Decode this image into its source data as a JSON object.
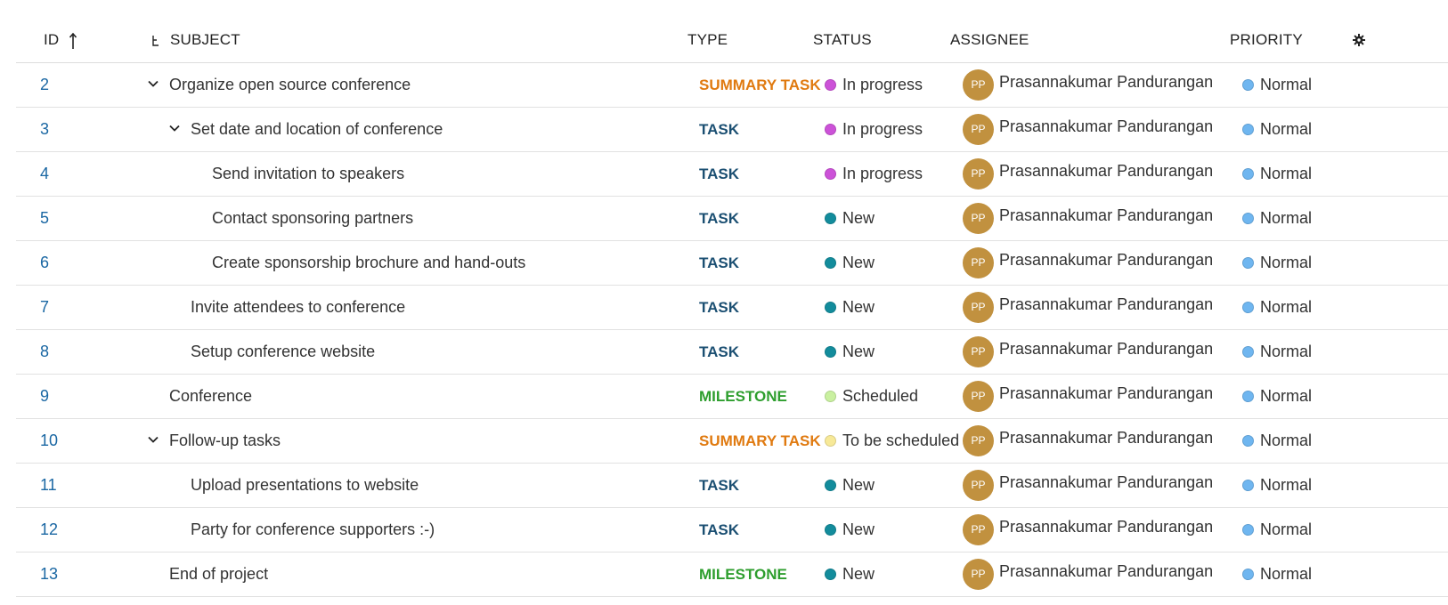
{
  "columns": {
    "id": "ID",
    "subject": "SUBJECT",
    "type": "TYPE",
    "status": "STATUS",
    "assignee": "ASSIGNEE",
    "priority": "PRIORITY"
  },
  "colors": {
    "link": "#1a67a3",
    "summary_task": "#e07a10",
    "task": "#1b4f72",
    "milestone": "#2e9e2e",
    "status_in_progress": "#cc52d8",
    "status_new": "#138c9c",
    "status_scheduled": "#c9f0a0",
    "status_to_be_scheduled": "#f7e998",
    "priority_normal": "#6fb6f0",
    "avatar": "#c1913f"
  },
  "rows": [
    {
      "id": "2",
      "subject": "Organize open source conference",
      "level": 0,
      "expanded": true,
      "type": "SUMMARY TASK",
      "type_key": "summary",
      "status": "In progress",
      "status_key": "in_progress",
      "avatar": "PP",
      "assignee": "Prasannakumar Pandurangan",
      "priority": "Normal"
    },
    {
      "id": "3",
      "subject": "Set date and location of conference",
      "level": 1,
      "expanded": true,
      "type": "TASK",
      "type_key": "task",
      "status": "In progress",
      "status_key": "in_progress",
      "avatar": "PP",
      "assignee": "Prasannakumar Pandurangan",
      "priority": "Normal"
    },
    {
      "id": "4",
      "subject": "Send invitation to speakers",
      "level": 2,
      "expanded": false,
      "type": "TASK",
      "type_key": "task",
      "status": "In progress",
      "status_key": "in_progress",
      "avatar": "PP",
      "assignee": "Prasannakumar Pandurangan",
      "priority": "Normal"
    },
    {
      "id": "5",
      "subject": "Contact sponsoring partners",
      "level": 2,
      "expanded": false,
      "type": "TASK",
      "type_key": "task",
      "status": "New",
      "status_key": "new",
      "avatar": "PP",
      "assignee": "Prasannakumar Pandurangan",
      "priority": "Normal"
    },
    {
      "id": "6",
      "subject": "Create sponsorship brochure and hand-outs",
      "level": 2,
      "expanded": false,
      "type": "TASK",
      "type_key": "task",
      "status": "New",
      "status_key": "new",
      "avatar": "PP",
      "assignee": "Prasannakumar Pandurangan",
      "priority": "Normal"
    },
    {
      "id": "7",
      "subject": "Invite attendees to conference",
      "level": 1,
      "expanded": false,
      "type": "TASK",
      "type_key": "task",
      "status": "New",
      "status_key": "new",
      "avatar": "PP",
      "assignee": "Prasannakumar Pandurangan",
      "priority": "Normal"
    },
    {
      "id": "8",
      "subject": "Setup conference website",
      "level": 1,
      "expanded": false,
      "type": "TASK",
      "type_key": "task",
      "status": "New",
      "status_key": "new",
      "avatar": "PP",
      "assignee": "Prasannakumar Pandurangan",
      "priority": "Normal"
    },
    {
      "id": "9",
      "subject": "Conference",
      "level": 0,
      "expanded": false,
      "type": "MILESTONE",
      "type_key": "milestone",
      "status": "Scheduled",
      "status_key": "scheduled",
      "avatar": "PP",
      "assignee": "Prasannakumar Pandurangan",
      "priority": "Normal"
    },
    {
      "id": "10",
      "subject": "Follow-up tasks",
      "level": 0,
      "expanded": true,
      "type": "SUMMARY TASK",
      "type_key": "summary",
      "status": "To be scheduled",
      "status_key": "to_be_scheduled",
      "avatar": "PP",
      "assignee": "Prasannakumar Pandurangan",
      "priority": "Normal"
    },
    {
      "id": "11",
      "subject": "Upload presentations to website",
      "level": 1,
      "expanded": false,
      "type": "TASK",
      "type_key": "task",
      "status": "New",
      "status_key": "new",
      "avatar": "PP",
      "assignee": "Prasannakumar Pandurangan",
      "priority": "Normal"
    },
    {
      "id": "12",
      "subject": "Party for conference supporters :-)",
      "level": 1,
      "expanded": false,
      "type": "TASK",
      "type_key": "task",
      "status": "New",
      "status_key": "new",
      "avatar": "PP",
      "assignee": "Prasannakumar Pandurangan",
      "priority": "Normal"
    },
    {
      "id": "13",
      "subject": "End of project",
      "level": 0,
      "expanded": false,
      "type": "MILESTONE",
      "type_key": "milestone",
      "status": "New",
      "status_key": "new",
      "avatar": "PP",
      "assignee": "Prasannakumar Pandurangan",
      "priority": "Normal"
    }
  ],
  "icons": {
    "sort": "arrow-up-icon",
    "hierarchy": "hierarchy-icon",
    "settings": "gear-icon",
    "expand": "chevron-down-icon"
  }
}
